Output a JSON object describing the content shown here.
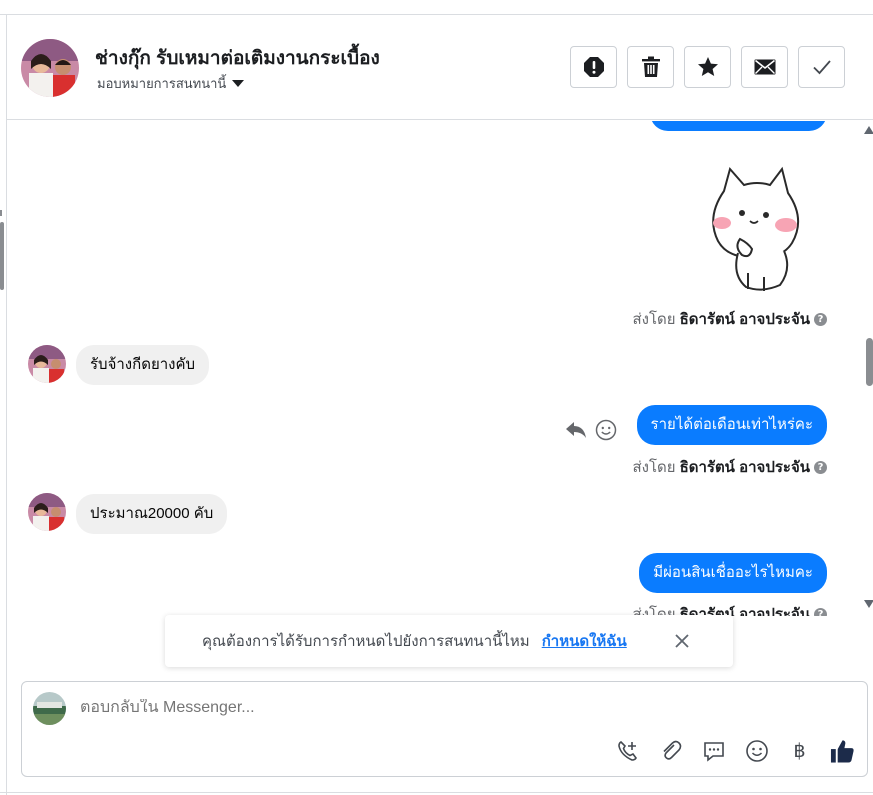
{
  "header": {
    "title": "ช่างกุ๊ก รับเหมาต่อเติมงานกระเบื้อง",
    "assign_label": "มอบหมายการสนทนานี้",
    "actions": [
      "alert-icon",
      "trash-icon",
      "star-icon",
      "envelope-icon",
      "check-icon"
    ]
  },
  "messages": {
    "sent_prefix": "ส่งโดย",
    "sender_name": "ธิดารัตน์ อาจประจัน",
    "incoming_1": "รับจ้างกีดยางคับ",
    "outgoing_1": "รายได้ต่อเดือนเท่าไหร่คะ",
    "incoming_2": "ประมาณ20000 คับ",
    "outgoing_2": "มีผ่อนสินเชื่ออะไรไหมคะ",
    "help_mark": "?"
  },
  "toast": {
    "text": "คุณต้องการได้รับการกำหนดไปยังการสนทนานี้ไหม",
    "link": "กำหนดให้ฉัน"
  },
  "composer": {
    "placeholder": "ตอบกลับใน Messenger...",
    "baht_symbol": "฿"
  },
  "colors": {
    "outgoing_bubble": "#0a7cff",
    "incoming_bubble": "#f0f0f0",
    "link": "#1877f2",
    "like": "#1c2b4a"
  }
}
